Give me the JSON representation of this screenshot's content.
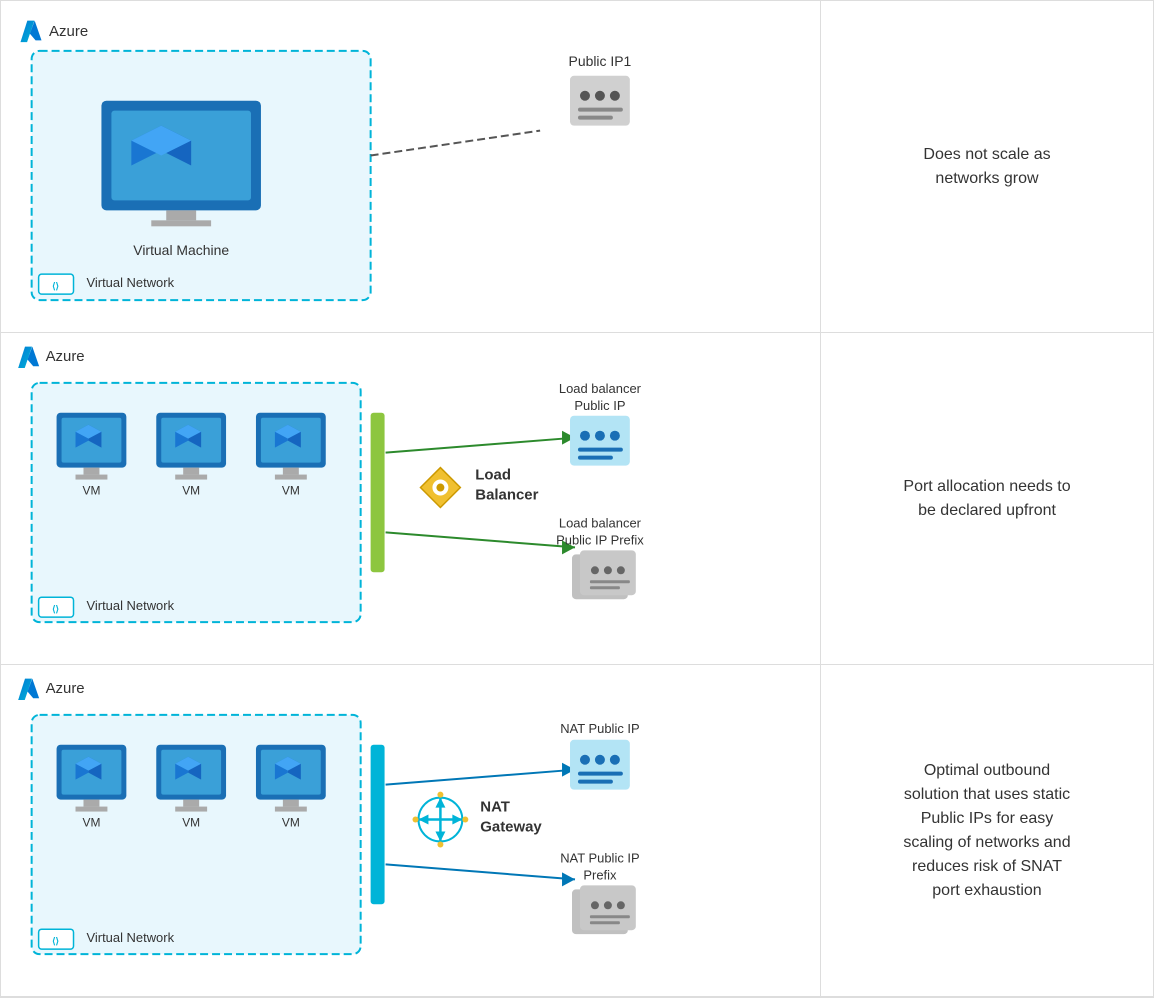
{
  "rows": [
    {
      "id": "row1",
      "azure_label": "Azure",
      "diagram": {
        "vnet_label": "Virtual Network",
        "vm_label": "Virtual Machine",
        "external_label": "Public IP1",
        "connection_type": "dashed"
      },
      "description": "Does not scale as\nnetworks grow"
    },
    {
      "id": "row2",
      "azure_label": "Azure",
      "diagram": {
        "vnet_label": "Virtual Network",
        "vm_labels": [
          "VM",
          "VM",
          "VM"
        ],
        "gateway_label": "Load\nBalancer",
        "external_labels": [
          "Load balancer\nPublic IP",
          "Load balancer\nPublic IP Prefix"
        ],
        "connection_type": "arrow-green"
      },
      "description": "Port allocation needs to\nbe declared upfront"
    },
    {
      "id": "row3",
      "azure_label": "Azure",
      "diagram": {
        "vnet_label": "Virtual Network",
        "vm_labels": [
          "VM",
          "VM",
          "VM"
        ],
        "gateway_label": "NAT\nGateway",
        "external_labels": [
          "NAT Public IP",
          "NAT Public IP\nPrefix"
        ],
        "connection_type": "arrow-blue"
      },
      "description": "Optimal outbound\nsolution that uses static\nPublic IPs for easy\nscaling of networks and\nreduces risk of SNAT\nport exhaustion"
    }
  ],
  "icons": {
    "azure_a": "A",
    "vnet_symbol": "⟨⟩",
    "load_balancer_symbol": "⊕",
    "nat_symbol": "⊕"
  }
}
